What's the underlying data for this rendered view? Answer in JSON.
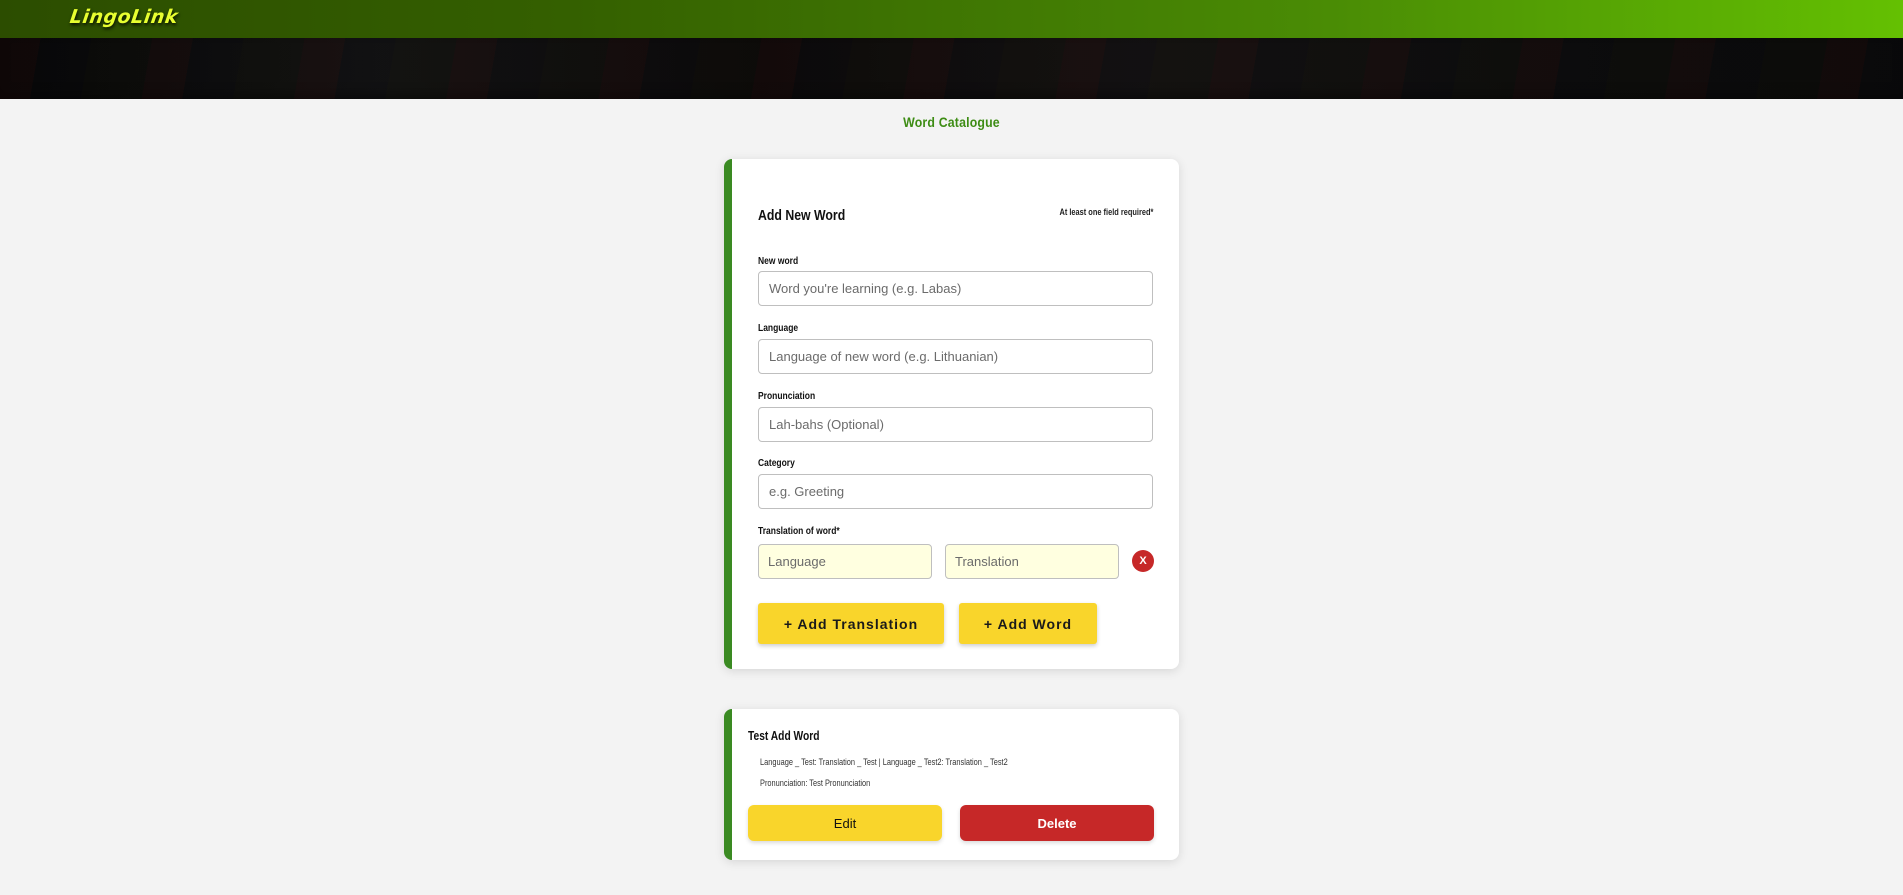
{
  "header": {
    "logo": "LingoLink"
  },
  "page": {
    "title": "Word Catalogue"
  },
  "form": {
    "heading": "Add New Word",
    "required_note": "At least one field required*",
    "fields": {
      "word": {
        "label": "New word",
        "placeholder": "Word you're learning (e.g. Labas)"
      },
      "language": {
        "label": "Language",
        "placeholder": "Language of new word (e.g. Lithuanian)"
      },
      "pronunciation": {
        "label": "Pronunciation",
        "placeholder": "Lah-bahs (Optional)"
      },
      "category": {
        "label": "Category",
        "placeholder": "e.g. Greeting"
      }
    },
    "translation": {
      "label": "Translation of word*",
      "language_placeholder": "Language",
      "translation_placeholder": "Translation",
      "remove_label": "X"
    },
    "add_translation_label": "+ Add Translation",
    "add_word_label": "+ Add Word"
  },
  "words": [
    {
      "title": "Test Add Word",
      "translations_line": "Language _ Test: Translation _ Test | Language _ Test2: Translation _ Test2",
      "pronunciation_line": "Pronunciation: Test Pronunciation",
      "edit_label": "Edit",
      "delete_label": "Delete"
    }
  ],
  "colors": {
    "accent_green": "#3a8a22",
    "button_yellow": "#f9d52b",
    "danger_red": "#c62828",
    "translation_bg": "#ffffe0"
  }
}
